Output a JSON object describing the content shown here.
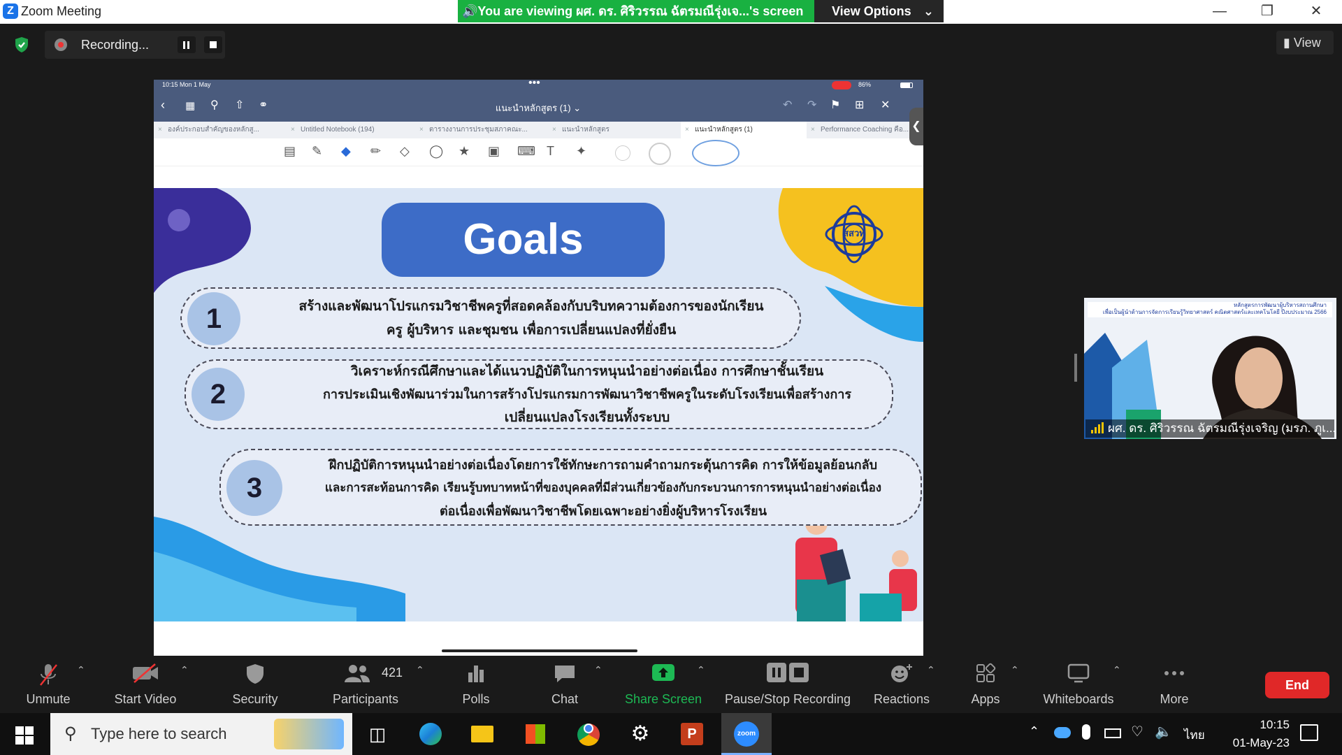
{
  "window": {
    "title": "Zoom Meeting"
  },
  "share_banner": {
    "text": "You are viewing ผศ. ดร. ศิริวรรณ ฉัตรมณีรุ่งเจ...'s screen",
    "view_options": "View Options"
  },
  "recording": {
    "label": "Recording..."
  },
  "view_button": {
    "label": "View"
  },
  "ipad": {
    "time": "10:15  Mon 1 May",
    "battery": "86%",
    "doc_title": "แนะนำหลักสูตร (1) ⌄",
    "tabs": [
      "องค์ประกอบสำคัญของหลักสู...",
      "Untitled Notebook (194)",
      "ตารางงานการประชุมสภาคณะ...",
      "แนะนำหลักสูตร",
      "แนะนำหลักสูตร (1)",
      "Performance Coaching คือ..."
    ]
  },
  "slide": {
    "title": "Goals",
    "items": [
      {
        "num": "1",
        "lines": [
          "สร้างและพัฒนาโปรแกรมวิชาชีพครูที่สอดคล้องกับบริบทความต้องการของนักเรียน",
          "ครู ผู้บริหาร และชุมชน เพื่อการเปลี่ยนแปลงที่ยั่งยืน"
        ]
      },
      {
        "num": "2",
        "lines": [
          "วิเคราะห์กรณีศึกษาและได้แนวปฏิบัติในการหนุนนำอย่างต่อเนื่อง การศึกษาชั้นเรียน",
          "การประเมินเชิงพัฒนาร่วมในการสร้างโปรแกรมการพัฒนาวิชาชีพครูในระดับโรงเรียนเพื่อสร้างการ",
          "เปลี่ยนแปลงโรงเรียนทั้งระบบ"
        ]
      },
      {
        "num": "3",
        "lines": [
          "ฝึกปฏิบัติการหนุนนำอย่างต่อเนื่องโดยการใช้ทักษะการถามคำถามกระตุ้นการคิด การให้ข้อมูลย้อนกลับ",
          "และการสะท้อนการคิด เรียนรู้บทบาทหน้าที่ของบุคคลที่มีส่วนเกี่ยวข้องกับกระบวนการการหนุนนำอย่างต่อเนื่อง",
          "ต่อเนื่องเพื่อพัฒนาวิชาชีพโดยเฉพาะอย่างยิ่งผู้บริหารโรงเรียน"
        ]
      }
    ],
    "logo_text": "สสวท"
  },
  "participant": {
    "name": "ผศ. ดร. ศิริวรรณ ฉัตรมณีรุ่งเจริญ (มรภ. ภูเ...",
    "banner_line1": "หลักสูตรการพัฒนาผู้บริหารสถานศึกษา",
    "banner_line2": "เพื่อเป็นผู้นำด้านการจัดการเรียนรู้วิทยาศาสตร์ คณิตศาสตร์และเทคโนโลยี ปีงบประมาณ 2566"
  },
  "controls": {
    "unmute": "Unmute",
    "start_video": "Start Video",
    "security": "Security",
    "participants": "Participants",
    "participant_count": "421",
    "polls": "Polls",
    "chat": "Chat",
    "share_screen": "Share Screen",
    "pause_stop": "Pause/Stop Recording",
    "reactions": "Reactions",
    "apps": "Apps",
    "whiteboards": "Whiteboards",
    "more": "More",
    "end": "End"
  },
  "taskbar": {
    "search_placeholder": "Type here to search",
    "time": "10:15",
    "date": "01-May-23",
    "language": "ไทย"
  },
  "colors": {
    "banner_green": "#19b141",
    "end_red": "#e02828",
    "share_green": "#1db954",
    "goal_blue": "#3d6cc7"
  }
}
